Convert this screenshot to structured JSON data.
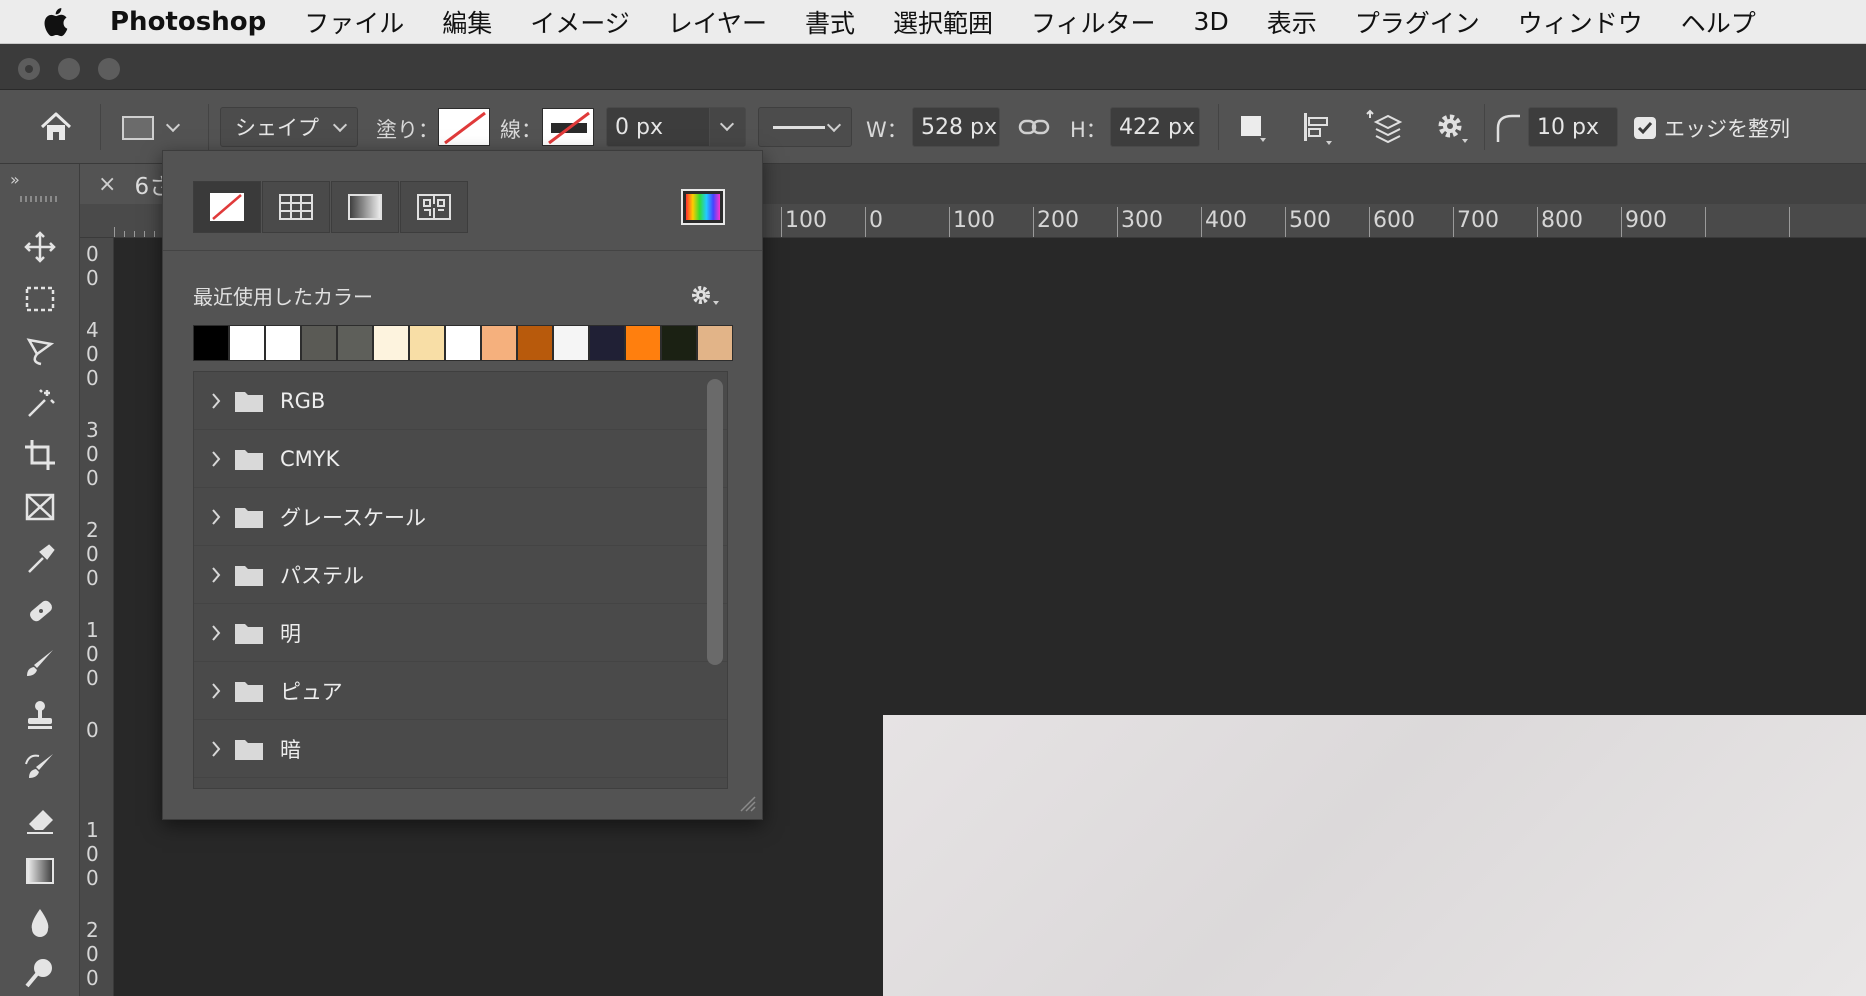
{
  "menubar": {
    "app_name": "Photoshop",
    "items": [
      "ファイル",
      "編集",
      "イメージ",
      "レイヤー",
      "書式",
      "選択範囲",
      "フィルター",
      "3D",
      "表示",
      "プラグイン",
      "ウィンドウ",
      "ヘルプ"
    ]
  },
  "options_bar": {
    "tool_mode": "シェイプ",
    "fill_label": "塗り：",
    "stroke_label": "線：",
    "stroke_width": "0 px",
    "width_label": "W：",
    "width_value": "528 px",
    "height_label": "H：",
    "height_value": "422 px",
    "radius_value": "10 px",
    "align_edges_label": "エッジを整列",
    "align_edges_checked": true
  },
  "document": {
    "tab_title": "6さ",
    "close_glyph": "×"
  },
  "ruler": {
    "top_labels": [
      "100",
      "0",
      "100",
      "200",
      "300",
      "400",
      "500",
      "600",
      "700",
      "800",
      "900"
    ],
    "left_groups": [
      [
        "0",
        "0"
      ],
      [
        "4",
        "0",
        "0"
      ],
      [
        "3",
        "0",
        "0"
      ],
      [
        "2",
        "0",
        "0"
      ],
      [
        "1",
        "0",
        "0"
      ],
      [
        "0"
      ],
      [
        "1",
        "0",
        "0"
      ],
      [
        "2",
        "0",
        "0"
      ]
    ]
  },
  "popup": {
    "recent_colors_label": "最近使用したカラー",
    "recent_colors": [
      "#000000",
      "#ffffff",
      "#ffffff",
      "#5a5a55",
      "#5e5f5a",
      "#fdf3de",
      "#f8dea6",
      "#ffffff",
      "#f5b07d",
      "#b85a0c",
      "#f5f5f5",
      "#202035",
      "#ff7f0e",
      "#1b2113",
      "#e2b488"
    ],
    "libraries": [
      "RGB",
      "CMYK",
      "グレースケール",
      "パステル",
      "明",
      "ピュア",
      "暗"
    ]
  },
  "colors": {
    "ui_panel": "#535353",
    "canvas_bg": "#282828",
    "no_color_red": "#e03a3a"
  }
}
